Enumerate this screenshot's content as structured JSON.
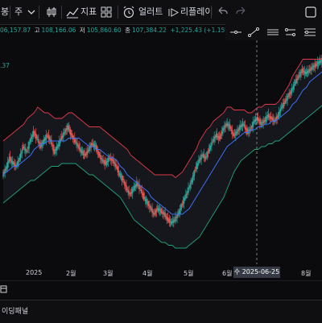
{
  "toolbar": {
    "symbol_label": "봉",
    "interval_label": "주",
    "indicators_label": "지표",
    "alert_label": "얼러트",
    "replay_label": "리플레이"
  },
  "legend": {
    "open": "06,157.87",
    "high_label": "고",
    "high": "108,166.06",
    "low_label": "저",
    "low": "105,860.60",
    "close_label": "종",
    "close": "107,384.22",
    "change": "+1,225.43 (+1.15%)",
    "ind_value": ".37"
  },
  "colors": {
    "up": "#26a69a",
    "down": "#ef5350",
    "band_upper": "#e0394a",
    "band_lower": "#1fa37a",
    "ma_blue": "#3d6ff2",
    "band_fill": "#15171d",
    "legend_green": "#26a69a",
    "crosshair": "#9598a1"
  },
  "icons": [
    "chevron-down-icon",
    "candle-icon",
    "indicators-icon",
    "grid-icon",
    "alert-icon",
    "replay-icon",
    "undo-icon",
    "redo-icon",
    "fullscreen-icon",
    "horizontal-line-icon",
    "trend-line-icon",
    "horizontal-ray-icon",
    "parallel-channel-icon",
    "fib-icon",
    "chart-panel-icon"
  ],
  "crosshair_label": "수 2025-06-25",
  "chart_data": {
    "type": "candlestick",
    "x_ticks": [
      "2025",
      "2월",
      "3월",
      "4월",
      "5월",
      "6월",
      "8월"
    ],
    "crosshair_x": "2025-06-25",
    "series": [
      {
        "name": "price",
        "values": [
          60,
          62,
          66,
          64,
          63,
          66,
          70,
          68,
          72,
          75,
          73,
          70,
          72,
          74,
          72,
          68,
          70,
          73,
          75,
          77,
          74,
          72,
          70,
          68,
          67,
          69,
          71,
          70,
          67,
          65,
          64,
          66,
          65,
          63,
          60,
          58,
          55,
          53,
          55,
          57,
          55,
          52,
          50,
          48,
          46,
          48,
          47,
          46,
          44,
          43,
          44,
          46,
          49,
          52,
          55,
          58,
          62,
          65,
          67,
          66,
          69,
          72,
          74,
          73,
          76,
          78,
          77,
          74,
          75,
          77,
          78,
          75,
          76,
          79,
          80,
          78,
          79,
          81,
          80,
          79,
          81,
          84,
          86,
          88,
          90,
          93,
          95,
          97,
          96,
          97,
          98,
          99,
          100,
          101
        ]
      },
      {
        "name": "ma",
        "values": [
          60,
          61,
          62,
          63,
          63,
          64,
          65,
          66,
          67,
          69,
          70,
          71,
          71,
          72,
          72,
          72,
          72,
          72,
          72,
          73,
          73,
          73,
          73,
          72,
          71,
          70,
          70,
          69,
          69,
          68,
          67,
          66,
          66,
          65,
          63,
          62,
          60,
          59,
          58,
          57,
          56,
          55,
          54,
          52,
          51,
          50,
          49,
          48,
          47,
          46,
          46,
          46,
          46,
          47,
          48,
          50,
          52,
          54,
          56,
          58,
          60,
          62,
          64,
          66,
          68,
          70,
          71,
          72,
          73,
          74,
          75,
          75,
          76,
          76,
          77,
          77,
          78,
          78,
          79,
          79,
          80,
          81,
          82,
          83,
          85,
          86,
          88,
          90,
          91,
          93,
          94,
          95,
          96,
          97
        ]
      },
      {
        "name": "upper_band",
        "values": [
          72,
          73,
          74,
          75,
          76,
          77,
          78,
          80,
          81,
          82,
          84,
          83,
          82,
          82,
          81,
          80,
          80,
          80,
          81,
          82,
          82,
          81,
          80,
          79,
          78,
          77,
          77,
          77,
          77,
          76,
          75,
          74,
          73,
          72,
          71,
          70,
          69,
          67,
          66,
          65,
          64,
          63,
          62,
          61,
          60,
          60,
          60,
          60,
          60,
          60,
          59,
          60,
          61,
          63,
          65,
          67,
          69,
          72,
          74,
          76,
          77,
          79,
          80,
          81,
          82,
          84,
          84,
          83,
          83,
          83,
          83,
          82,
          82,
          83,
          84,
          84,
          85,
          85,
          85,
          85,
          86,
          88,
          90,
          92,
          95,
          97,
          99,
          101,
          101,
          101,
          101,
          101,
          101,
          102
        ]
      },
      {
        "name": "lower_band",
        "values": [
          50,
          51,
          52,
          53,
          54,
          55,
          56,
          57,
          58,
          58,
          59,
          60,
          61,
          62,
          63,
          63,
          63,
          64,
          64,
          64,
          64,
          64,
          63,
          62,
          61,
          60,
          60,
          59,
          58,
          57,
          56,
          55,
          54,
          53,
          52,
          50,
          48,
          46,
          44,
          43,
          42,
          41,
          40,
          39,
          38,
          37,
          36,
          36,
          35,
          35,
          34,
          34,
          34,
          34,
          35,
          36,
          37,
          38,
          40,
          42,
          44,
          46,
          48,
          50,
          52,
          55,
          58,
          61,
          63,
          65,
          66,
          67,
          68,
          69,
          69,
          70,
          70,
          71,
          71,
          72,
          72,
          73,
          74,
          75,
          76,
          77,
          78,
          79,
          80,
          81,
          82,
          83,
          84,
          85
        ]
      }
    ]
  }
}
